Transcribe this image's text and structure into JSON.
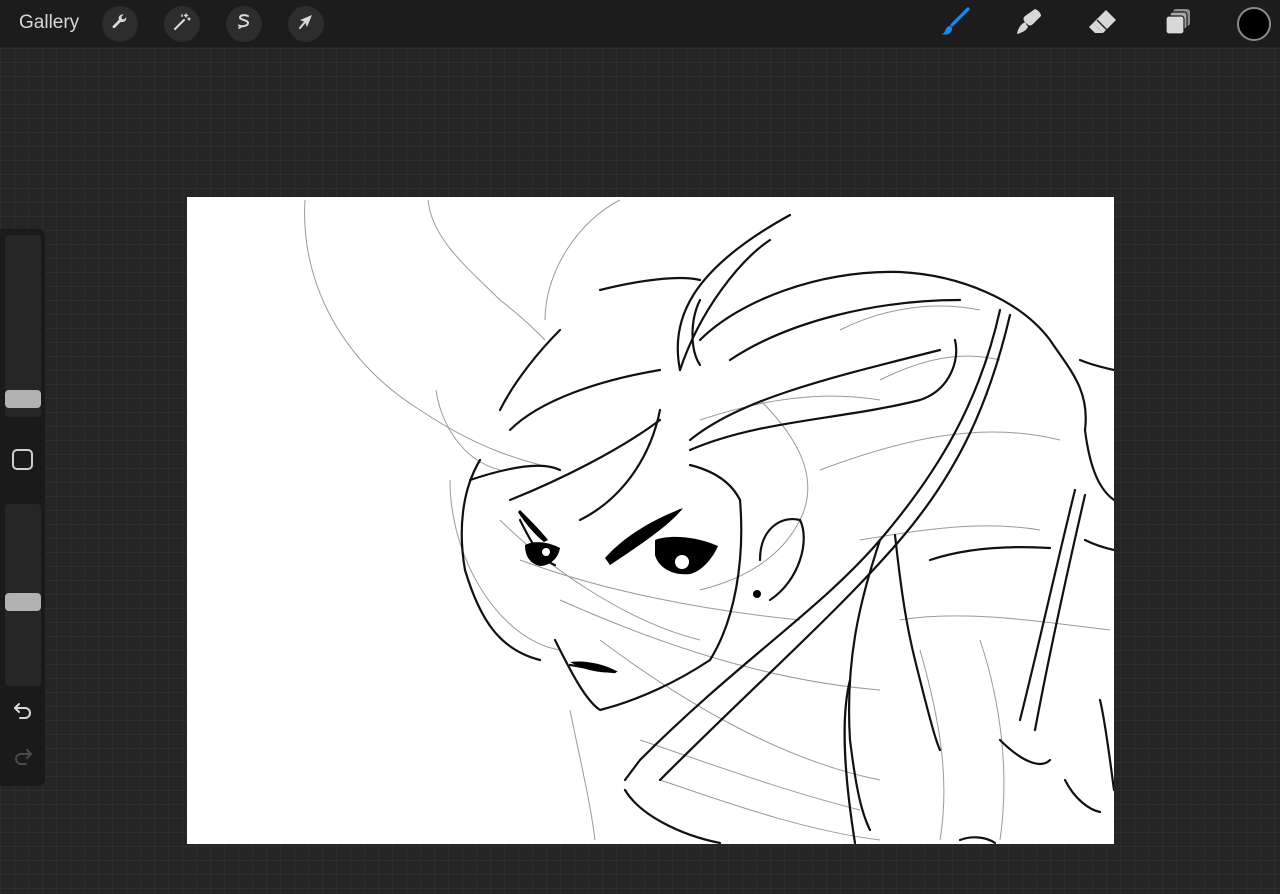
{
  "topbar": {
    "gallery_label": "Gallery",
    "left_tools": [
      {
        "name": "actions",
        "icon": "wrench-icon"
      },
      {
        "name": "adjustments",
        "icon": "magic-wand-icon"
      },
      {
        "name": "selection",
        "icon": "selection-s-icon"
      },
      {
        "name": "transform",
        "icon": "arrow-cursor-icon"
      }
    ],
    "right_tools": [
      {
        "name": "brush",
        "icon": "brush-icon",
        "active": true
      },
      {
        "name": "smudge",
        "icon": "smudge-icon",
        "active": false
      },
      {
        "name": "eraser",
        "icon": "eraser-icon",
        "active": false
      },
      {
        "name": "layers",
        "icon": "layers-icon",
        "active": false
      }
    ],
    "current_color": "#000000",
    "active_tool_color": "#1e88f0"
  },
  "sidebar": {
    "brush_size_level": 0.1,
    "opacity_level": 0.5,
    "modify_icon": "square-icon",
    "undo_icon": "undo-arrow-icon",
    "redo_icon": "redo-arrow-icon",
    "redo_enabled": false
  },
  "canvas": {
    "background": "#ffffff",
    "content": "line-art-sketch"
  }
}
